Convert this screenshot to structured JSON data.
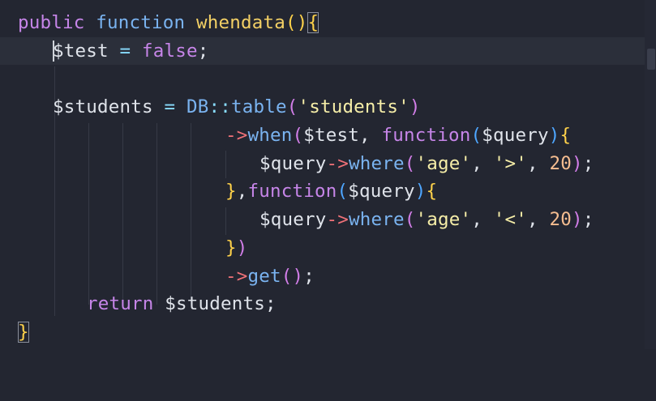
{
  "editor": {
    "language": "php",
    "theme_colors": {
      "background": "#232631",
      "keyword": "#c685e8",
      "function": "#7ab3f0",
      "string": "#f6eea8",
      "number": "#f5bd90",
      "arrow": "#f07178"
    },
    "lines": [
      {
        "tokens": [
          {
            "cls": "t-kw",
            "text": "public"
          },
          {
            "cls": "t-punc",
            "text": " "
          },
          {
            "cls": "t-fn",
            "text": "function"
          },
          {
            "cls": "t-punc",
            "text": " "
          },
          {
            "cls": "t-name",
            "text": "whendata"
          },
          {
            "cls": "t-br1",
            "text": "()"
          },
          {
            "cls": "t-br1",
            "text": "{"
          }
        ]
      },
      {
        "tokens": [
          {
            "cls": "t-var",
            "text": "$test"
          },
          {
            "cls": "t-op",
            "text": " = "
          },
          {
            "cls": "t-kw",
            "text": "false"
          },
          {
            "cls": "t-punc",
            "text": ";"
          }
        ]
      },
      {
        "tokens": []
      },
      {
        "tokens": [
          {
            "cls": "t-var",
            "text": "$students"
          },
          {
            "cls": "t-op",
            "text": " = "
          },
          {
            "cls": "t-class",
            "text": "DB"
          },
          {
            "cls": "t-op",
            "text": "::"
          },
          {
            "cls": "t-fn",
            "text": "table"
          },
          {
            "cls": "t-br2",
            "text": "("
          },
          {
            "cls": "t-str",
            "text": "'students'"
          },
          {
            "cls": "t-br2",
            "text": ")"
          }
        ]
      },
      {
        "tokens": [
          {
            "cls": "t-arrow",
            "text": "->"
          },
          {
            "cls": "t-fn",
            "text": "when"
          },
          {
            "cls": "t-br2",
            "text": "("
          },
          {
            "cls": "t-var",
            "text": "$test"
          },
          {
            "cls": "t-punc",
            "text": ", "
          },
          {
            "cls": "t-kw",
            "text": "function"
          },
          {
            "cls": "t-br3",
            "text": "("
          },
          {
            "cls": "t-var",
            "text": "$query"
          },
          {
            "cls": "t-br3",
            "text": ")"
          },
          {
            "cls": "t-br1",
            "text": "{"
          }
        ]
      },
      {
        "tokens": [
          {
            "cls": "t-var",
            "text": "$query"
          },
          {
            "cls": "t-arrow",
            "text": "->"
          },
          {
            "cls": "t-fn",
            "text": "where"
          },
          {
            "cls": "t-br2",
            "text": "("
          },
          {
            "cls": "t-str",
            "text": "'age'"
          },
          {
            "cls": "t-punc",
            "text": ", "
          },
          {
            "cls": "t-str",
            "text": "'>'"
          },
          {
            "cls": "t-punc",
            "text": ", "
          },
          {
            "cls": "t-num",
            "text": "20"
          },
          {
            "cls": "t-br2",
            "text": ")"
          },
          {
            "cls": "t-punc",
            "text": ";"
          }
        ]
      },
      {
        "tokens": [
          {
            "cls": "t-br1",
            "text": "}"
          },
          {
            "cls": "t-punc",
            "text": ","
          },
          {
            "cls": "t-kw",
            "text": "function"
          },
          {
            "cls": "t-br3",
            "text": "("
          },
          {
            "cls": "t-var",
            "text": "$query"
          },
          {
            "cls": "t-br3",
            "text": ")"
          },
          {
            "cls": "t-br1",
            "text": "{"
          }
        ]
      },
      {
        "tokens": [
          {
            "cls": "t-var",
            "text": "$query"
          },
          {
            "cls": "t-arrow",
            "text": "->"
          },
          {
            "cls": "t-fn",
            "text": "where"
          },
          {
            "cls": "t-br2",
            "text": "("
          },
          {
            "cls": "t-str",
            "text": "'age'"
          },
          {
            "cls": "t-punc",
            "text": ", "
          },
          {
            "cls": "t-str",
            "text": "'<'"
          },
          {
            "cls": "t-punc",
            "text": ", "
          },
          {
            "cls": "t-num",
            "text": "20"
          },
          {
            "cls": "t-br2",
            "text": ")"
          },
          {
            "cls": "t-punc",
            "text": ";"
          }
        ]
      },
      {
        "tokens": [
          {
            "cls": "t-br1",
            "text": "}"
          },
          {
            "cls": "t-br2",
            "text": ")"
          }
        ]
      },
      {
        "tokens": [
          {
            "cls": "t-arrow",
            "text": "->"
          },
          {
            "cls": "t-fn",
            "text": "get"
          },
          {
            "cls": "t-br2",
            "text": "()"
          },
          {
            "cls": "t-punc",
            "text": ";"
          }
        ]
      },
      {
        "tokens": [
          {
            "cls": "t-kw",
            "text": "return"
          },
          {
            "cls": "t-punc",
            "text": " "
          },
          {
            "cls": "t-var",
            "text": "$students"
          },
          {
            "cls": "t-punc",
            "text": ";"
          }
        ]
      },
      {
        "tokens": [
          {
            "cls": "t-br1",
            "text": "}"
          }
        ]
      }
    ]
  }
}
